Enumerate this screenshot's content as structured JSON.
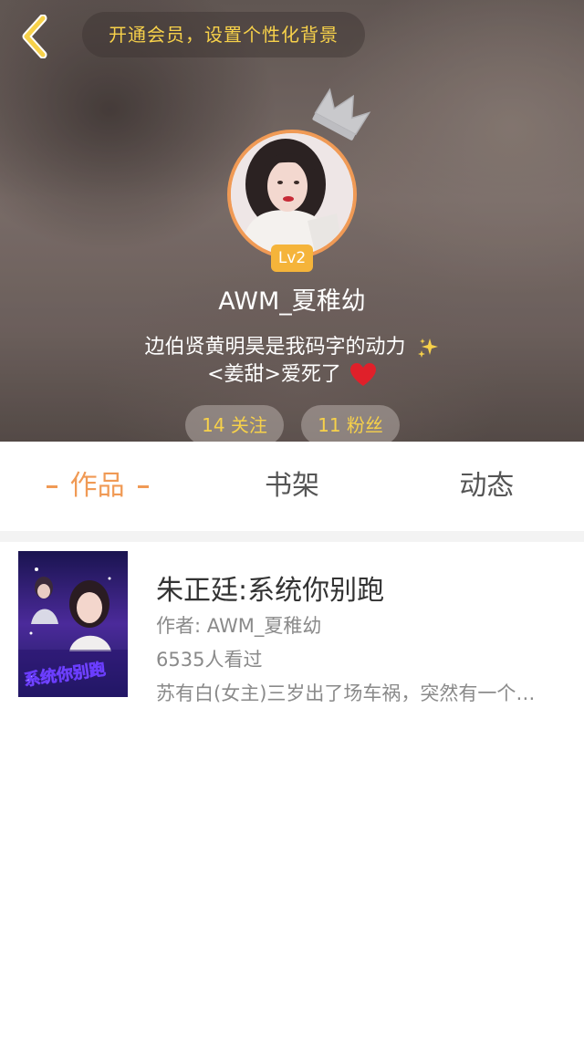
{
  "header": {
    "vip_banner": "开通会员，设置个性化背景",
    "level_badge": "Lv2",
    "username": "AWM_夏稚幼",
    "bio_line1": "边伯贤黄明昊是我码字的动力",
    "bio_line2": "<姜甜>爱死了",
    "following_label": "14 关注",
    "fans_label": "11 粉丝"
  },
  "tabs": [
    {
      "label": "作品",
      "active": true
    },
    {
      "label": "书架",
      "active": false
    },
    {
      "label": "动态",
      "active": false
    }
  ],
  "books": [
    {
      "title": "朱正廷:系统你别跑",
      "author": "作者: AWM_夏稚幼",
      "views": "6535人看过",
      "summary": "苏有白(女主)三岁出了场车祸，突然有一个系统",
      "cover_text": "系统你别跑"
    }
  ],
  "colors": {
    "accent_orange": "#f09a55",
    "vip_yellow": "#f7d14a",
    "badge_gold": "#f5b43a",
    "heart_red": "#e0202a"
  },
  "icons": [
    "back-arrow-icon",
    "crown-icon",
    "sparkle-icon",
    "heart-icon"
  ]
}
